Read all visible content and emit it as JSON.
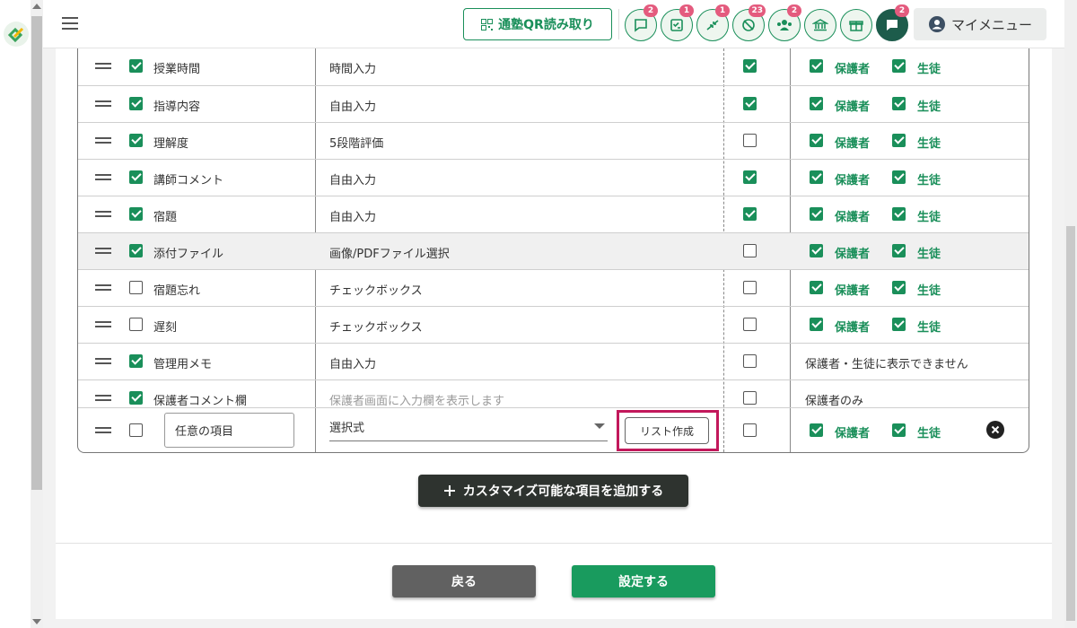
{
  "header": {
    "qr_button_label": "通塾QR読み取り",
    "icon_badges": [
      "2",
      "1",
      "1",
      "23",
      "2",
      "",
      "",
      "2"
    ],
    "my_menu_label": "マイメニュー"
  },
  "table": {
    "visibility_labels": {
      "guardian": "保護者",
      "student": "生徒"
    },
    "rows": [
      {
        "name": "授業時間",
        "enabled": true,
        "type": "時間入力",
        "type_muted": false,
        "required": true,
        "visibility": "both",
        "guardian": true,
        "student": true,
        "note": ""
      },
      {
        "name": "指導内容",
        "enabled": true,
        "type": "自由入力",
        "type_muted": false,
        "required": true,
        "visibility": "both",
        "guardian": true,
        "student": true,
        "note": ""
      },
      {
        "name": "理解度",
        "enabled": true,
        "type": "5段階評価",
        "type_muted": false,
        "required": false,
        "visibility": "both",
        "guardian": true,
        "student": true,
        "note": ""
      },
      {
        "name": "講師コメント",
        "enabled": true,
        "type": "自由入力",
        "type_muted": false,
        "required": true,
        "visibility": "both",
        "guardian": true,
        "student": true,
        "note": ""
      },
      {
        "name": "宿題",
        "enabled": true,
        "type": "自由入力",
        "type_muted": false,
        "required": true,
        "visibility": "both",
        "guardian": true,
        "student": true,
        "note": ""
      },
      {
        "name": "添付ファイル",
        "enabled": true,
        "type": "画像/PDFファイル選択",
        "type_muted": false,
        "required": false,
        "visibility": "both",
        "guardian": true,
        "student": true,
        "note": "",
        "highlight": true
      },
      {
        "name": "宿題忘れ",
        "enabled": false,
        "type": "チェックボックス",
        "type_muted": false,
        "required": false,
        "visibility": "both",
        "guardian": true,
        "student": true,
        "note": ""
      },
      {
        "name": "遅刻",
        "enabled": false,
        "type": "チェックボックス",
        "type_muted": false,
        "required": false,
        "visibility": "both",
        "guardian": true,
        "student": true,
        "note": ""
      },
      {
        "name": "管理用メモ",
        "enabled": true,
        "type": "自由入力",
        "type_muted": false,
        "required": false,
        "visibility": "note",
        "note": "保護者・生徒に表示できません"
      },
      {
        "name": "保護者コメント欄",
        "enabled": true,
        "type": "保護者画面に入力欄を表示します",
        "type_muted": true,
        "required": false,
        "visibility": "note",
        "note": "保護者のみ"
      }
    ],
    "custom_row": {
      "enabled": false,
      "name_value": "任意の項目",
      "type_selected": "選択式",
      "list_button_label": "リスト作成",
      "required": false,
      "guardian": true,
      "student": true
    }
  },
  "actions": {
    "add_custom_label": "カスタマイズ可能な項目を追加する",
    "back_label": "戻る",
    "save_label": "設定する"
  }
}
